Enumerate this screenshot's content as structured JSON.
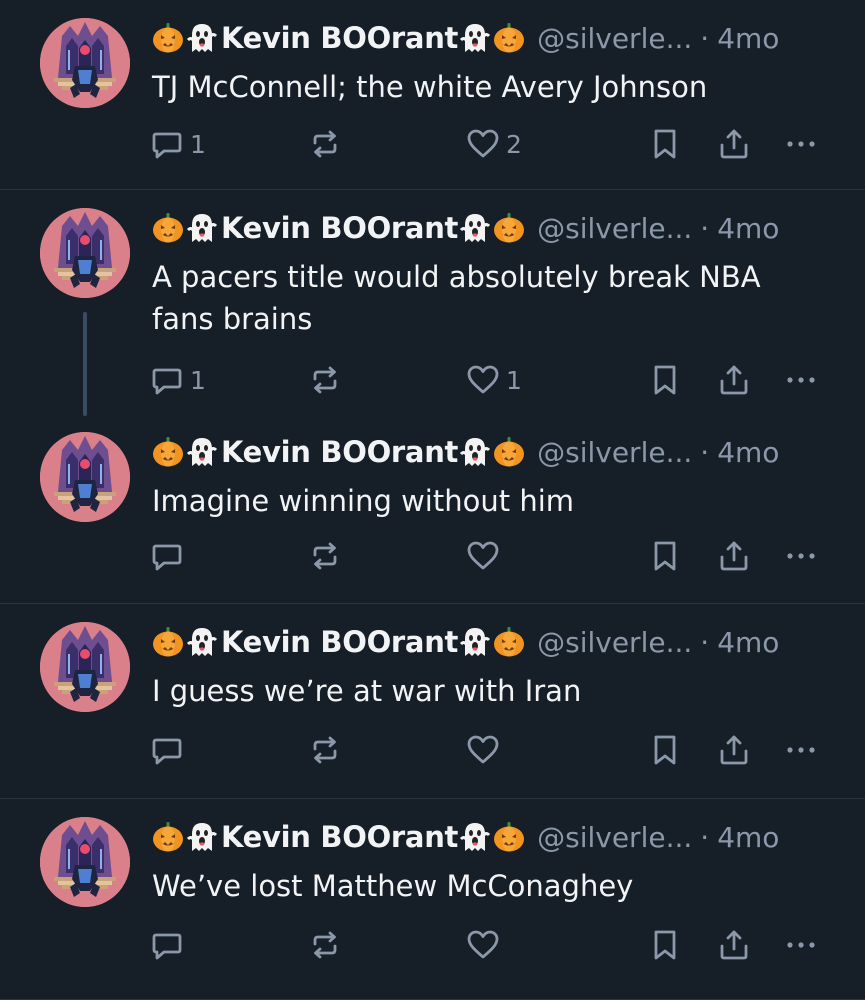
{
  "posts": [
    {
      "display_name": "Kevin BOOrant",
      "handle": "@silverle...",
      "separator": "·",
      "time": "4mo",
      "text": "TJ McConnell; the white Avery Johnson",
      "reply_count": "1",
      "like_count": "2"
    },
    {
      "display_name": "Kevin BOOrant",
      "handle": "@silverle...",
      "separator": "·",
      "time": "4mo",
      "text": "A pacers title would absolutely break NBA fans brains",
      "reply_count": "1",
      "like_count": "1"
    },
    {
      "display_name": "Kevin BOOrant",
      "handle": "@silverle...",
      "separator": "·",
      "time": "4mo",
      "text": "Imagine winning without him",
      "reply_count": "",
      "like_count": ""
    },
    {
      "display_name": "Kevin BOOrant",
      "handle": "@silverle...",
      "separator": "·",
      "time": "4mo",
      "text": "I guess we’re at war with Iran",
      "reply_count": "",
      "like_count": ""
    },
    {
      "display_name": "Kevin BOOrant",
      "handle": "@silverle...",
      "separator": "·",
      "time": "4mo",
      "text": "We’ve lost Matthew McConaghey",
      "reply_count": "",
      "like_count": ""
    }
  ],
  "icons": {
    "name_emojis": [
      "pumpkin-icon",
      "ghost-icon",
      "ghost-icon",
      "pumpkin-icon"
    ],
    "actions": [
      "reply-icon",
      "repost-icon",
      "like-icon",
      "bookmark-icon",
      "share-icon",
      "more-icon"
    ]
  },
  "colors": {
    "background": "#161e27",
    "text": "#f1f3f5",
    "muted": "#8b98a9",
    "divider": "#2a3441",
    "thread_line": "#3b4b63",
    "pumpkin": "#f29422"
  }
}
